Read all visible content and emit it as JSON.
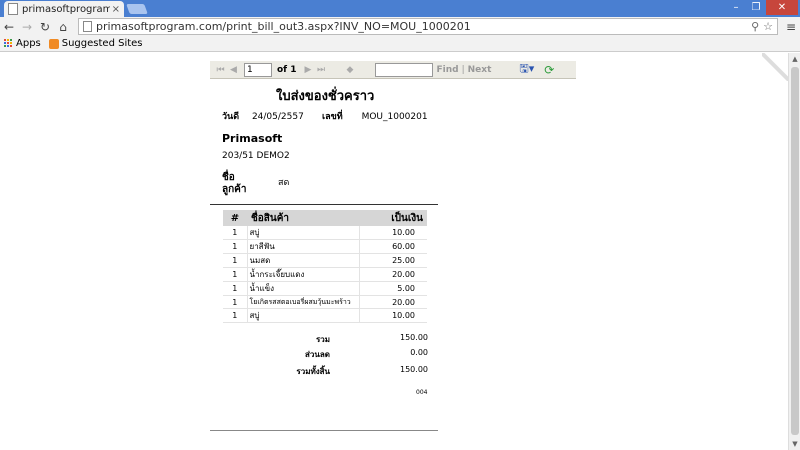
{
  "browser": {
    "tab_title": "primasoftprogram.co",
    "tab_close": "×",
    "url": "primasoftprogram.com/print_bill_out3.aspx?INV_NO=MOU_1000201",
    "bookmarks": [
      {
        "label": "Apps"
      },
      {
        "label": "Suggested Sites"
      }
    ]
  },
  "viewer": {
    "page_current": "1",
    "page_total_label": "of 1",
    "find_label": "Find",
    "separator": "|",
    "next_label": "Next"
  },
  "report": {
    "title": "ใบส่งของชั่วคราว",
    "date_label": "วันดี",
    "date_value": "24/05/2557",
    "number_label": "เลขที่",
    "number_value": "MOU_1000201",
    "company": "Primasoft",
    "address": "203/51   DEMO2",
    "customer_label": "ชื่อ ลูกค้า",
    "customer_value": "สด",
    "table": {
      "headers": {
        "qty": "#",
        "name": "ชื่อสินค้า",
        "amount": "เป็นเงิน"
      },
      "rows": [
        {
          "qty": "1",
          "name": "สบู่",
          "amount": "10.00"
        },
        {
          "qty": "1",
          "name": "ยาสีฟัน",
          "amount": "60.00"
        },
        {
          "qty": "1",
          "name": "นมสด",
          "amount": "25.00"
        },
        {
          "qty": "1",
          "name": "น้ำกระเจี๊ยบแดง",
          "amount": "20.00"
        },
        {
          "qty": "1",
          "name": "น้ำแข็ง",
          "amount": "5.00"
        },
        {
          "qty": "1",
          "name": "โยเกิตรสสตอเบอรี่ผสมวุ้นมะพร้าว",
          "amount": "20.00"
        },
        {
          "qty": "1",
          "name": "สบู่",
          "amount": "10.00"
        }
      ]
    },
    "totals": [
      {
        "label": "รวม",
        "value": "150.00"
      },
      {
        "label": "ส่วนลด",
        "value": "0.00"
      },
      {
        "label": "รวมทั้งสิ้น",
        "value": "150.00"
      }
    ],
    "code": "004"
  }
}
